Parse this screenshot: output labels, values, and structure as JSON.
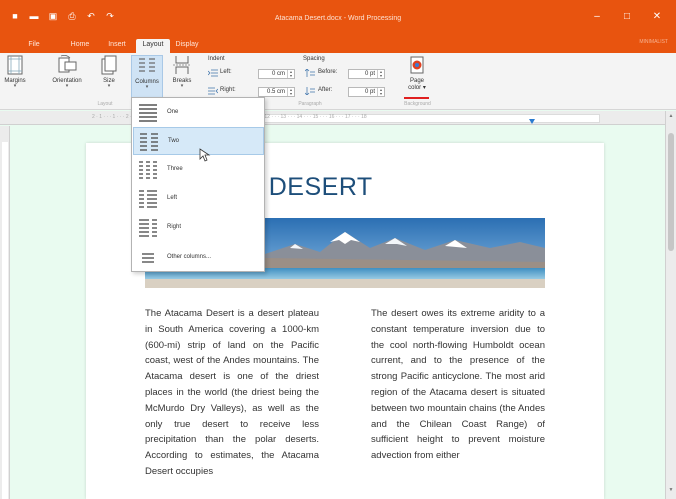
{
  "window": {
    "title": "Atacama Desert.docx - Word Processing"
  },
  "quick_access": [
    "new-icon",
    "open-icon",
    "save-icon",
    "print-icon",
    "undo-icon",
    "redo-icon"
  ],
  "tabs": [
    {
      "label": "File",
      "active": false
    },
    {
      "label": "Home",
      "active": false
    },
    {
      "label": "Insert",
      "active": false
    },
    {
      "label": "Layout",
      "active": true
    },
    {
      "label": "Display",
      "active": false
    }
  ],
  "mode_link": "MINIMALIST",
  "ribbon": {
    "margins": "Margins",
    "orientation": "Orientation",
    "size": "Size",
    "columns": "Columns",
    "breaks": "Breaks",
    "indent_title": "Indent",
    "indent_left_label": "Left:",
    "indent_left_value": "0 cm",
    "indent_right_label": "Right:",
    "indent_right_value": "0.5 cm",
    "spacing_title": "Spacing",
    "spacing_before_label": "Before:",
    "spacing_before_value": "0 pt",
    "spacing_after_label": "After:",
    "spacing_after_value": "0 pt",
    "page_color_line1": "Page",
    "page_color_line2": "color",
    "group_layout": "Layout",
    "group_paragraph": "Paragraph",
    "group_background": "Background"
  },
  "ruler_numbers": "2 · 1 · · · 1 · · · 2 · · · 3 · · · 4 · · · 5 · · · 6 · · · 7 · · · 8 · · · 9 · · · 10 · · · 11 · · · 12 · · · 13 · · · 14 · · · 15 · · · 16 · · · 17 · · · 18",
  "columns_menu": {
    "items": [
      {
        "label": "One",
        "icon": "one-column-icon"
      },
      {
        "label": "Two",
        "icon": "two-columns-icon",
        "selected": true
      },
      {
        "label": "Three",
        "icon": "three-columns-icon"
      },
      {
        "label": "Left",
        "icon": "left-column-icon"
      },
      {
        "label": "Right",
        "icon": "right-column-icon"
      },
      {
        "label": "Other columns...",
        "icon": "other-columns-icon"
      }
    ]
  },
  "document": {
    "title": "AMA DESERT",
    "col1": "The Atacama Desert is a desert plateau in South America covering a 1000-km (600-mi) strip of land on the Pacific coast, west of the Andes mountains. The Atacama desert is one of the driest places in the world (the driest being the McMurdo Dry Valleys), as well as the only true desert to receive less precipitation than the polar deserts. According to estimates, the Atacama Desert occupies",
    "col2": "The desert owes its extreme aridity to a constant temperature inversion due to the cool north-flowing Humboldt ocean current, and to the presence of the strong Pacific anticyclone. The most arid region of the Atacama desert is situated between two mountain chains (the Andes and the Chilean Coast Range) of sufficient height to prevent moisture advection from either"
  },
  "colors": {
    "accent": "#e8540f",
    "title_blue": "#1d4e7a",
    "selection": "#d6e9f8"
  }
}
